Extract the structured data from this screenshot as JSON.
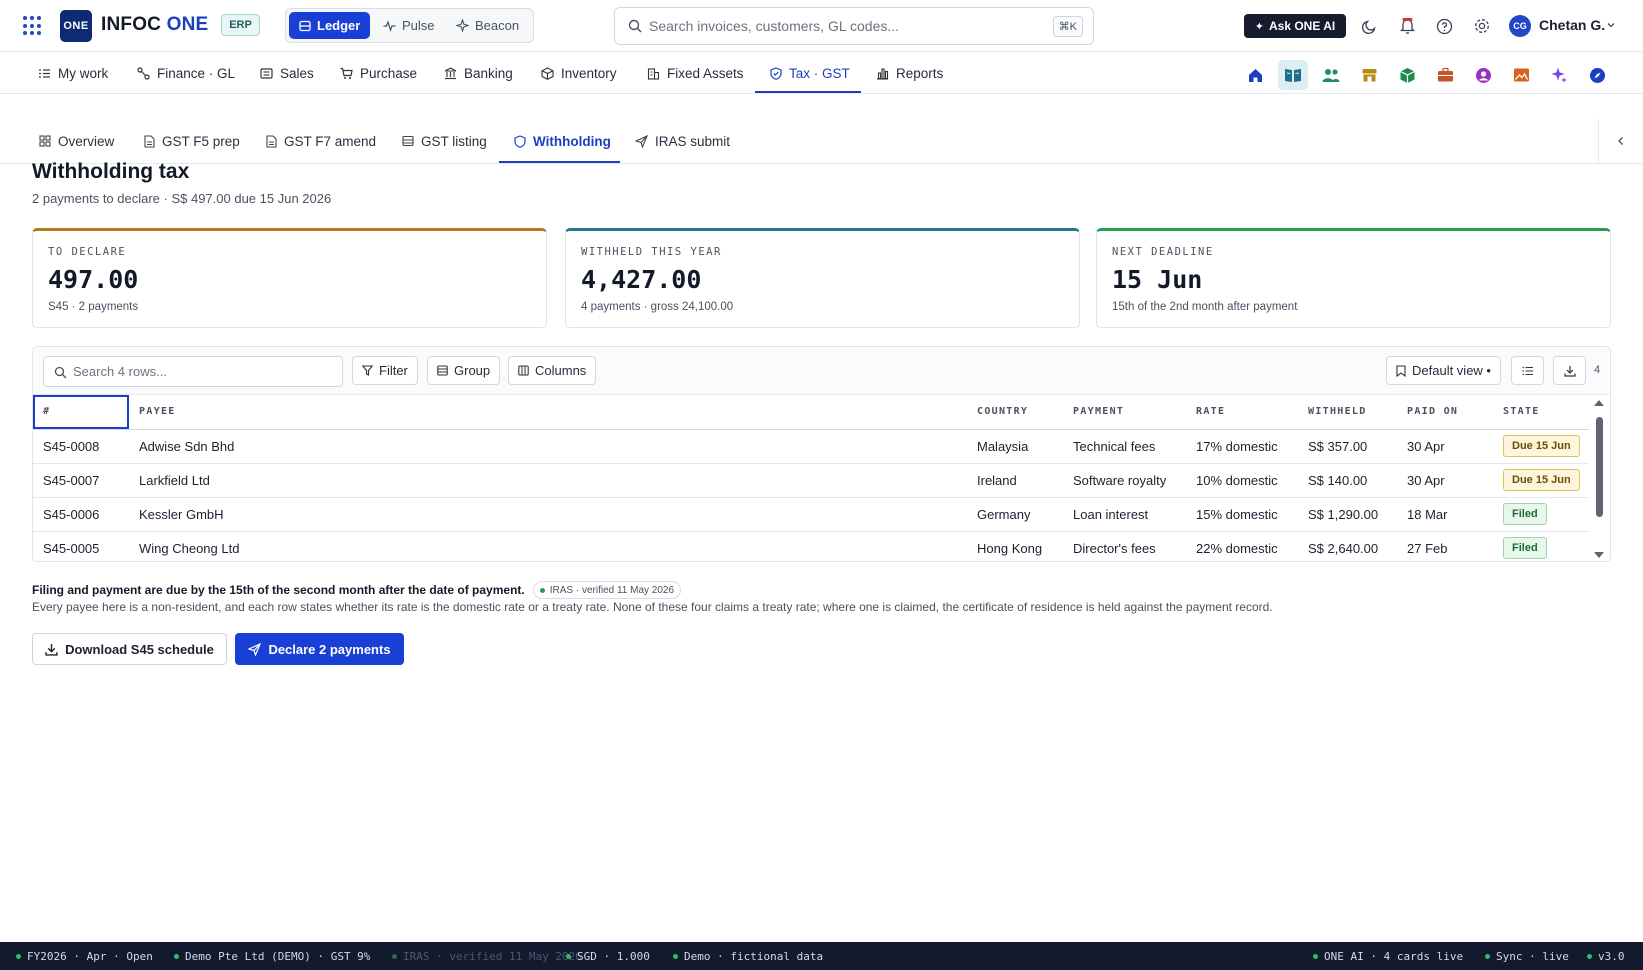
{
  "topbar": {
    "logo": "ONE",
    "brand_main": "INFOC",
    "brand_accent": "ONE",
    "erp_badge": "ERP",
    "modes": [
      {
        "label": "Ledger",
        "icon": "ledger-icon",
        "active": true
      },
      {
        "label": "Pulse",
        "icon": "pulse-icon",
        "active": false
      },
      {
        "label": "Beacon",
        "icon": "beacon-icon",
        "active": false
      }
    ],
    "search_placeholder": "Search invoices, customers, GL codes...",
    "search_shortcut": "⌘K",
    "ask_ai_label": "Ask ONE AI",
    "user_initials": "CG",
    "user_name": "Chetan G."
  },
  "module_nav": [
    {
      "label": "My work",
      "icon": "checklist-icon"
    },
    {
      "label": "Finance · GL",
      "icon": "finance-icon"
    },
    {
      "label": "Sales",
      "icon": "receipt-icon"
    },
    {
      "label": "Purchase",
      "icon": "cart-icon"
    },
    {
      "label": "Banking",
      "icon": "bank-icon"
    },
    {
      "label": "Inventory",
      "icon": "box-icon"
    },
    {
      "label": "Fixed Assets",
      "icon": "building-icon"
    },
    {
      "label": "Tax · GST",
      "icon": "shield-icon",
      "active": true
    },
    {
      "label": "Reports",
      "icon": "bar-chart-icon"
    }
  ],
  "app_tiles": [
    "home-icon",
    "book-icon",
    "people-icon",
    "store-icon",
    "cube-icon",
    "briefcase-icon",
    "user-circle-icon",
    "image-icon",
    "sparkle-icon",
    "compass-icon"
  ],
  "sub_tabs": [
    {
      "label": "Overview",
      "icon": "grid-icon"
    },
    {
      "label": "GST F5 prep",
      "icon": "doc-icon"
    },
    {
      "label": "GST F7 amend",
      "icon": "doc-icon"
    },
    {
      "label": "GST listing",
      "icon": "list-icon"
    },
    {
      "label": "Withholding",
      "icon": "shield-icon",
      "active": true
    },
    {
      "label": "IRAS submit",
      "icon": "send-icon"
    }
  ],
  "page": {
    "title": "Withholding tax",
    "subtitle": "2 payments to declare · S$ 497.00 due 15 Jun 2026"
  },
  "kpis": [
    {
      "label": "TO DECLARE",
      "value": "497.00",
      "note": "S45 · 2 payments",
      "accent": "#b7791f"
    },
    {
      "label": "WITHHELD THIS YEAR",
      "value": "4,427.00",
      "note": "4 payments · gross 24,100.00",
      "accent": "#1f7a8c"
    },
    {
      "label": "NEXT DEADLINE",
      "value": "15 Jun",
      "note": "15th of the 2nd month after payment",
      "accent": "#2a9d54"
    }
  ],
  "toolbar": {
    "search_placeholder": "Search 4 rows...",
    "filter": "Filter",
    "group": "Group",
    "columns": "Columns",
    "view": "Default view •",
    "row_count": "4"
  },
  "table": {
    "headers": [
      "#",
      "PAYEE",
      "COUNTRY",
      "PAYMENT",
      "RATE",
      "WITHHELD",
      "PAID ON",
      "STATE"
    ],
    "rows": [
      {
        "id": "S45-0008",
        "payee": "Adwise Sdn Bhd",
        "country": "Malaysia",
        "payment": "Technical fees",
        "rate": "17% domestic",
        "withheld": "S$ 357.00",
        "paid_on": "30 Apr",
        "state": "Due 15 Jun",
        "state_kind": "due"
      },
      {
        "id": "S45-0007",
        "payee": "Larkfield Ltd",
        "country": "Ireland",
        "payment": "Software royalty",
        "rate": "10% domestic",
        "withheld": "S$ 140.00",
        "paid_on": "30 Apr",
        "state": "Due 15 Jun",
        "state_kind": "due"
      },
      {
        "id": "S45-0006",
        "payee": "Kessler GmbH",
        "country": "Germany",
        "payment": "Loan interest",
        "rate": "15% domestic",
        "withheld": "S$ 1,290.00",
        "paid_on": "18 Mar",
        "state": "Filed",
        "state_kind": "filed"
      },
      {
        "id": "S45-0005",
        "payee": "Wing Cheong Ltd",
        "country": "Hong Kong",
        "payment": "Director's fees",
        "rate": "22% domestic",
        "withheld": "S$ 2,640.00",
        "paid_on": "27 Feb",
        "state": "Filed",
        "state_kind": "filed"
      }
    ]
  },
  "notes": {
    "headline": "Filing and payment are due by the 15th of the second month after the date of payment.",
    "verified": "IRAS · verified 11 May 2026",
    "body": "Every payee here is a non-resident, and each row states whether its rate is the domestic rate or a treaty rate. None of these four claims a treaty rate; where one is claimed, the certificate of residence is held against the payment record."
  },
  "actions": {
    "download": "Download S45 schedule",
    "declare": "Declare 2 payments"
  },
  "statusbar": {
    "fy": "FY2026 · Apr · Open",
    "entity": "Demo Pte Ltd (DEMO) · GST 9%",
    "iras": "IRAS · verified 11 May 2026",
    "fx": "SGD · 1.000",
    "demo": "Demo · fictional data",
    "ai": "ONE AI · 4 cards live",
    "sync": "Sync · live",
    "version": "v3.0"
  }
}
